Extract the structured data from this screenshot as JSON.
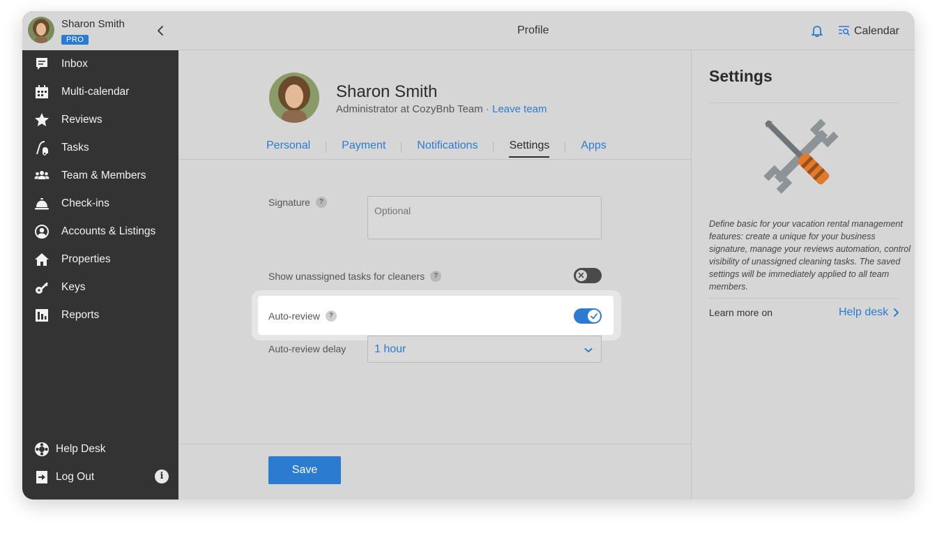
{
  "user": {
    "name": "Sharon Smith",
    "badge": "PRO"
  },
  "nav": [
    {
      "label": "Inbox",
      "icon": "inbox-icon"
    },
    {
      "label": "Multi-calendar",
      "icon": "calendar-grid-icon"
    },
    {
      "label": "Reviews",
      "icon": "star-icon"
    },
    {
      "label": "Tasks",
      "icon": "vacuum-icon"
    },
    {
      "label": "Team & Members",
      "icon": "team-icon"
    },
    {
      "label": "Check-ins",
      "icon": "service-bell-icon"
    },
    {
      "label": "Accounts & Listings",
      "icon": "user-circle-icon"
    },
    {
      "label": "Properties",
      "icon": "home-icon"
    },
    {
      "label": "Keys",
      "icon": "key-icon"
    },
    {
      "label": "Reports",
      "icon": "bar-chart-icon"
    }
  ],
  "sidebar_bottom": {
    "help_desk": "Help Desk",
    "log_out": "Log Out",
    "info_glyph": "i"
  },
  "header": {
    "title": "Profile",
    "calendar_label": "Calendar"
  },
  "profile": {
    "name": "Sharon Smith",
    "role": "Administrator at CozyBnb Team",
    "separator": " · ",
    "leave_label": "Leave team"
  },
  "tabs": [
    {
      "label": "Personal",
      "active": false
    },
    {
      "label": "Payment",
      "active": false
    },
    {
      "label": "Notifications",
      "active": false
    },
    {
      "label": "Settings",
      "active": true
    },
    {
      "label": "Apps",
      "active": false
    }
  ],
  "form": {
    "signature_label": "Signature",
    "signature_placeholder": "Optional",
    "unassigned_label": "Show unassigned tasks for cleaners",
    "unassigned_enabled": false,
    "auto_review_label": "Auto-review",
    "auto_review_enabled": true,
    "delay_label": "Auto-review delay",
    "delay_value": "1 hour",
    "help_glyph": "?"
  },
  "save_label": "Save",
  "settings_panel": {
    "title": "Settings",
    "description": "Define basic for your vacation rental management features: create a unique for your business signature, manage your reviews automation, control visibility of unassigned cleaning tasks. The saved settings will be immediately applied to all team members.",
    "learn_more": "Learn more on",
    "help_link": "Help desk"
  },
  "colors": {
    "accent": "#2b7bd0",
    "sidebar": "#333333",
    "background": "#d6d6d6"
  }
}
